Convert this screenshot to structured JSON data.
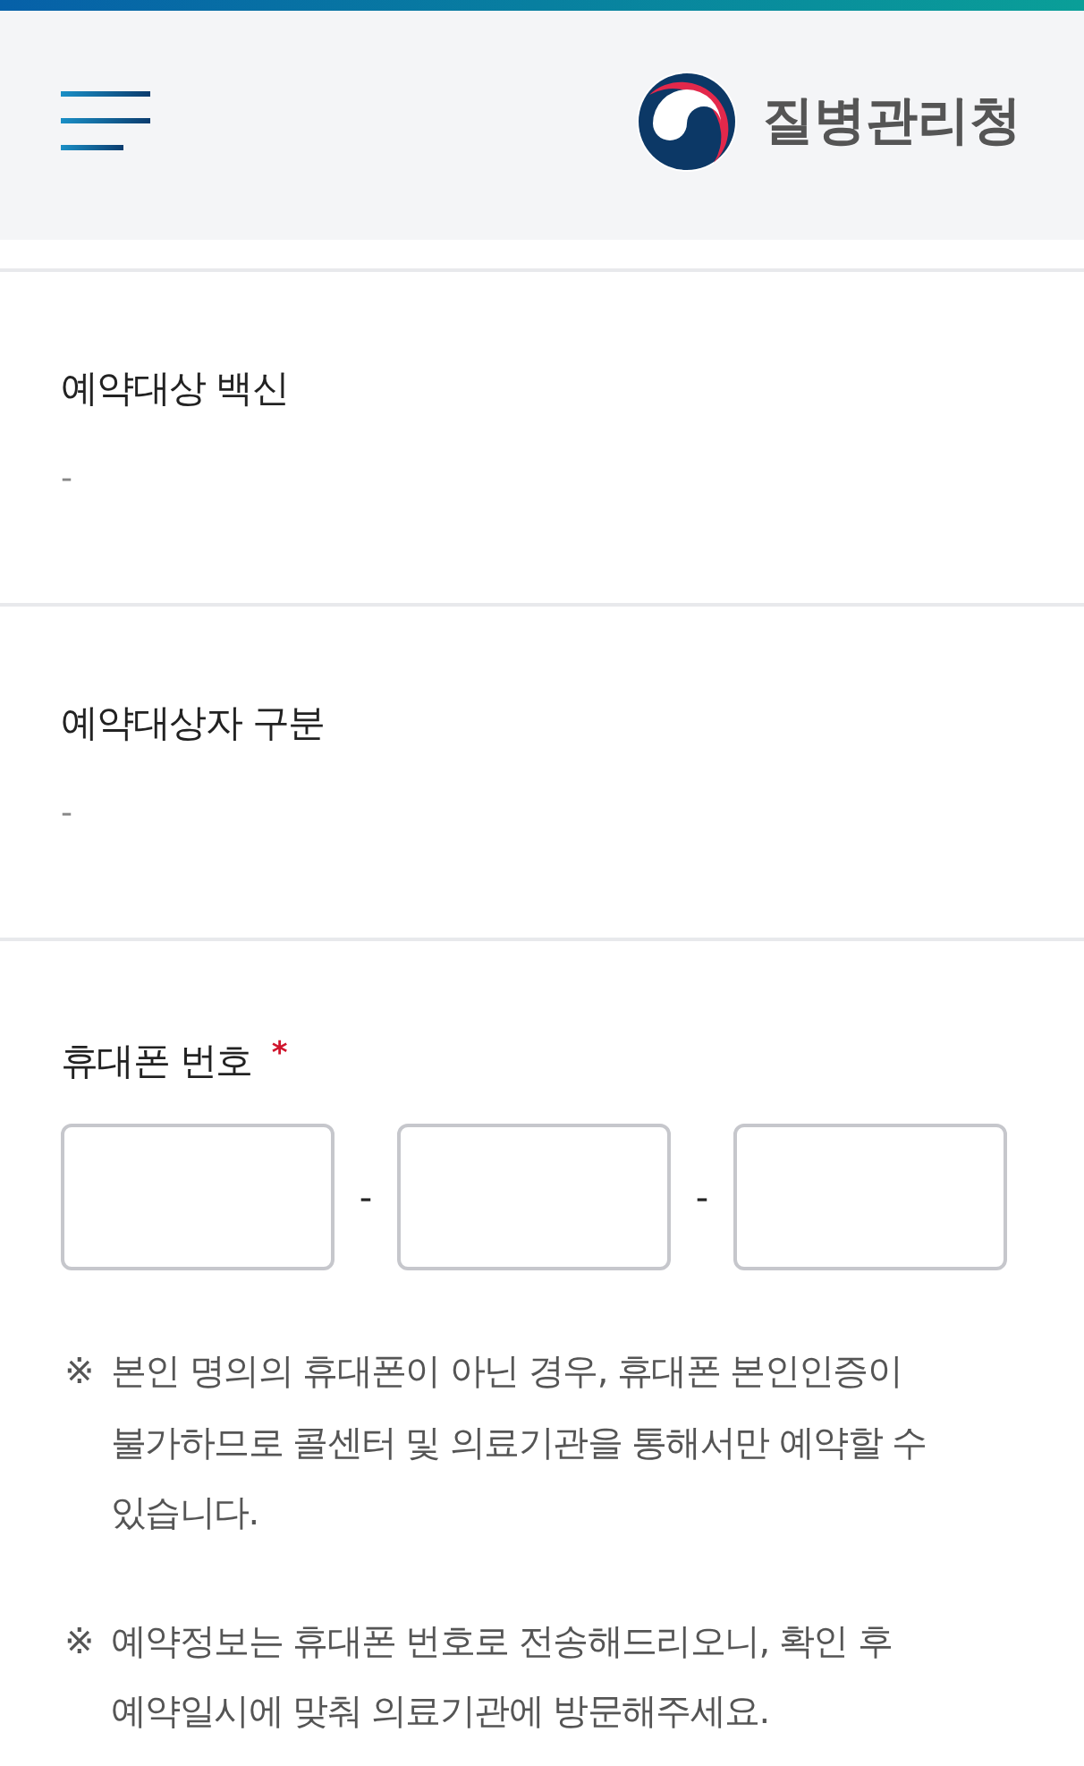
{
  "header": {
    "logo_text": "질병관리청"
  },
  "info_fields": [
    {
      "label": "예약대상 백신",
      "value": "-"
    },
    {
      "label": "예약대상자 구분",
      "value": "-"
    }
  ],
  "phone": {
    "label": "휴대폰 번호",
    "required_mark": "*",
    "parts": [
      {
        "kind": "input"
      },
      {
        "kind": "separator",
        "text": "-"
      },
      {
        "kind": "input"
      },
      {
        "kind": "separator",
        "text": "-"
      },
      {
        "kind": "input"
      }
    ]
  },
  "notes": [
    {
      "mark": "※",
      "text": "본인 명의의 휴대폰이 아닌 경우, 휴대폰 본인인증이 불가하므로 콜센터 및 의료기관을 통해서만 예약할 수 있습니다."
    },
    {
      "mark": "※",
      "text": "예약정보는 휴대폰 번호로 전송해드리오니, 확인 후 예약일시에 맞춰 의료기관에 방문해주세요."
    }
  ]
}
